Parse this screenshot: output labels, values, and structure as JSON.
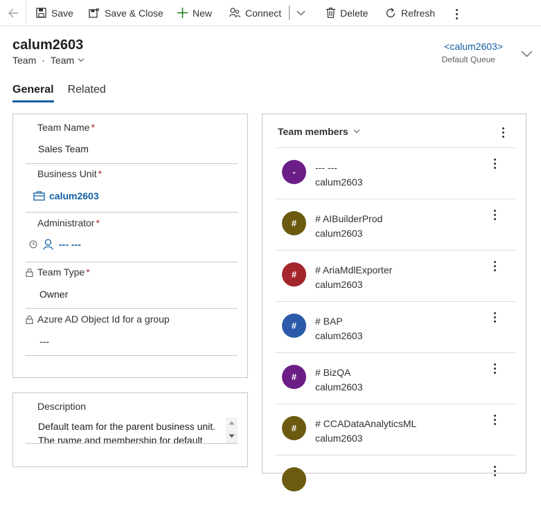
{
  "toolbar": {
    "back_icon": "back-arrow-icon",
    "save": "Save",
    "save_close": "Save & Close",
    "new": "New",
    "connect": "Connect",
    "delete": "Delete",
    "refresh": "Refresh"
  },
  "header": {
    "title": "calum2603",
    "entity": "Team",
    "form": "Team",
    "owner_link": "<calum2603>",
    "owner_sub": "Default Queue"
  },
  "tabs": [
    {
      "label": "General",
      "active": true
    },
    {
      "label": "Related",
      "active": false
    }
  ],
  "fields": {
    "team_name": {
      "label": "Team Name",
      "value": "Sales Team",
      "required": "*"
    },
    "business_unit": {
      "label": "Business Unit",
      "value": "calum2603",
      "required": "*"
    },
    "administrator": {
      "label": "Administrator",
      "value": "--- ---",
      "required": "*"
    },
    "team_type": {
      "label": "Team Type",
      "value": "Owner",
      "required": "*"
    },
    "azure_ad": {
      "label": "Azure AD Object Id for a group",
      "value": "---"
    }
  },
  "description": {
    "label": "Description",
    "line1": "Default team for the parent business unit.",
    "line2": "The name and membership for default"
  },
  "members": {
    "title": "Team members",
    "items": [
      {
        "avatar": "-",
        "name": "--- ---",
        "sub": "calum2603",
        "color": "#6b1f86"
      },
      {
        "avatar": "#",
        "name": "# AIBuilderProd",
        "sub": "calum2603",
        "color": "#6b5a10"
      },
      {
        "avatar": "#",
        "name": "# AriaMdlExporter",
        "sub": "calum2603",
        "color": "#a4262c"
      },
      {
        "avatar": "#",
        "name": "# BAP",
        "sub": "calum2603",
        "color": "#2b5aa8"
      },
      {
        "avatar": "#",
        "name": "# BizQA",
        "sub": "calum2603",
        "color": "#6b1f86"
      },
      {
        "avatar": "#",
        "name": "# CCADataAnalyticsML",
        "sub": "calum2603",
        "color": "#6b5a10"
      }
    ]
  }
}
